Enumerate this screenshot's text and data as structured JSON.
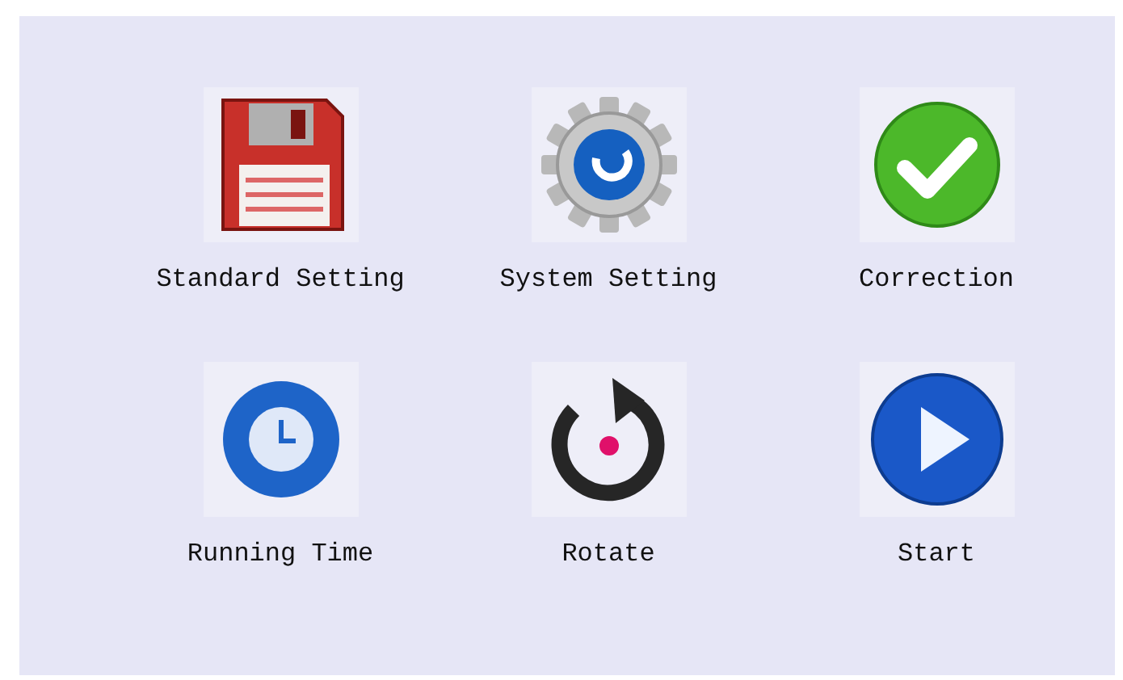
{
  "buttons": [
    {
      "label": "Standard Setting",
      "kind": "floppy"
    },
    {
      "label": "System Setting",
      "kind": "gear"
    },
    {
      "label": "Correction",
      "kind": "check"
    },
    {
      "label": "Running Time",
      "kind": "clock"
    },
    {
      "label": "Rotate",
      "kind": "rotate"
    },
    {
      "label": "Start",
      "kind": "play"
    }
  ]
}
